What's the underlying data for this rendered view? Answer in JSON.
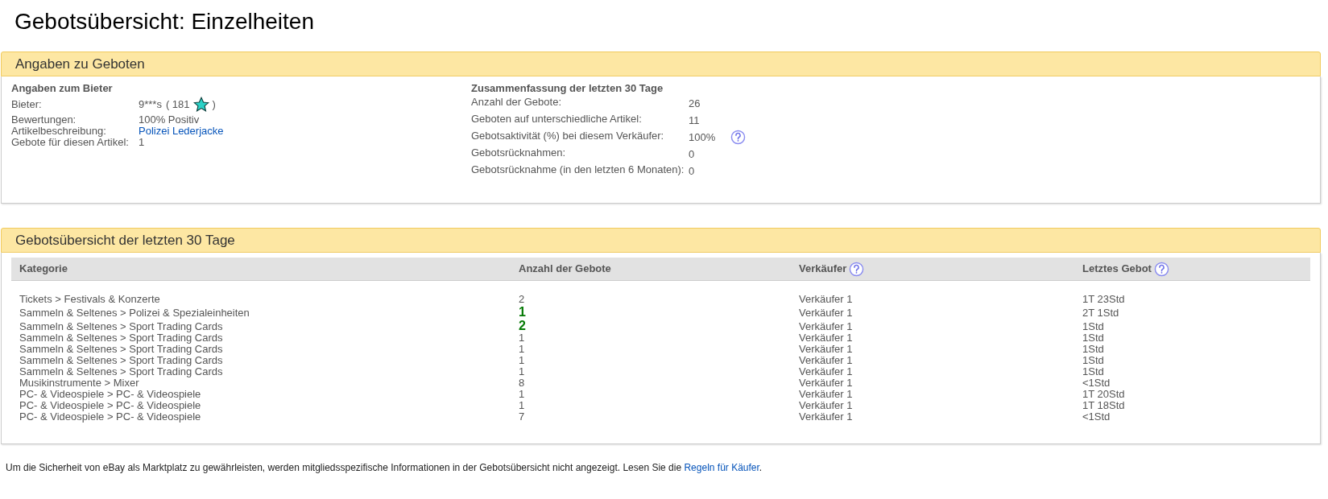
{
  "page_title": "Gebotsübersicht: Einzelheiten",
  "bid_info": {
    "title": "Angaben zu Geboten",
    "bidder": {
      "heading": "Angaben zum Bieter",
      "bidder_label": "Bieter:",
      "bidder_name": "9***s",
      "score_open": "( 181",
      "score_close": ")",
      "rows": [
        {
          "label": "Bewertungen:",
          "value": "100% Positiv",
          "kind": "text"
        },
        {
          "label": "Artikelbeschreibung:",
          "value": "Polizei Lederjacke",
          "kind": "link"
        },
        {
          "label": "Gebote für diesen Artikel:",
          "value": "1",
          "kind": "text"
        }
      ]
    },
    "summary": {
      "heading": "Zusammenfassung der letzten 30 Tage",
      "rows": [
        {
          "label": "Anzahl der Gebote:",
          "value": "26",
          "help": false
        },
        {
          "label": "Geboten auf unterschiedliche Artikel:",
          "value": "11",
          "help": false
        },
        {
          "label": "Gebotsaktivität (%) bei diesem Verkäufer:",
          "value": "100%",
          "help": true
        },
        {
          "label": "Gebotsrücknahmen:",
          "value": "0",
          "help": false
        },
        {
          "label": "Gebotsrücknahme (in den letzten 6 Monaten):",
          "value": "0",
          "help": false
        }
      ]
    }
  },
  "history": {
    "title": "Gebotsübersicht der letzten 30 Tage",
    "columns": [
      {
        "label": "Kategorie",
        "help": false
      },
      {
        "label": "Anzahl der Gebote",
        "help": false
      },
      {
        "label": "Verkäufer",
        "help": true
      },
      {
        "label": "Letztes Gebot",
        "help": true
      }
    ],
    "rows": [
      {
        "category": "Tickets > Festivals & Konzerte",
        "count": "2",
        "highlight": false,
        "seller": "Verkäufer 1",
        "last_bid": "1T 23Std"
      },
      {
        "category": "Sammeln & Seltenes > Polizei & Spezialeinheiten",
        "count": "1",
        "highlight": true,
        "seller": "Verkäufer 1",
        "last_bid": "2T 1Std"
      },
      {
        "category": "Sammeln & Seltenes > Sport Trading Cards",
        "count": "2",
        "highlight": true,
        "seller": "Verkäufer 1",
        "last_bid": "1Std"
      },
      {
        "category": "Sammeln & Seltenes > Sport Trading Cards",
        "count": "1",
        "highlight": false,
        "seller": "Verkäufer 1",
        "last_bid": "1Std"
      },
      {
        "category": "Sammeln & Seltenes > Sport Trading Cards",
        "count": "1",
        "highlight": false,
        "seller": "Verkäufer 1",
        "last_bid": "1Std"
      },
      {
        "category": "Sammeln & Seltenes > Sport Trading Cards",
        "count": "1",
        "highlight": false,
        "seller": "Verkäufer 1",
        "last_bid": "1Std"
      },
      {
        "category": "Sammeln & Seltenes > Sport Trading Cards",
        "count": "1",
        "highlight": false,
        "seller": "Verkäufer 1",
        "last_bid": "1Std"
      },
      {
        "category": "Musikinstrumente > Mixer",
        "count": "8",
        "highlight": false,
        "seller": "Verkäufer 1",
        "last_bid": "<1Std"
      },
      {
        "category": "PC- & Videospiele > PC- & Videospiele",
        "count": "1",
        "highlight": false,
        "seller": "Verkäufer 1",
        "last_bid": "1T 20Std"
      },
      {
        "category": "PC- & Videospiele > PC- & Videospiele",
        "count": "1",
        "highlight": false,
        "seller": "Verkäufer 1",
        "last_bid": "1T 18Std"
      },
      {
        "category": "PC- & Videospiele > PC- & Videospiele",
        "count": "7",
        "highlight": false,
        "seller": "Verkäufer 1",
        "last_bid": "<1Std"
      }
    ]
  },
  "footer": {
    "text": "Um die Sicherheit von eBay als Marktplatz zu gewährleisten, werden mitgliedsspezifische Informationen in der Gebotsübersicht nicht angezeigt. Lesen Sie die",
    "link": "Regeln für Käufer",
    "suffix": "."
  }
}
